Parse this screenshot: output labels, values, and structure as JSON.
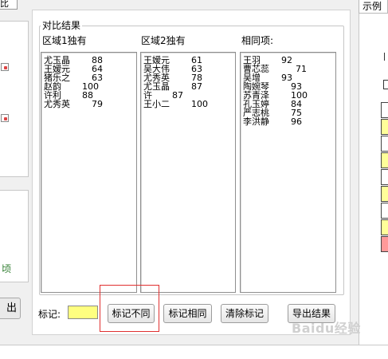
{
  "left_tab_label": "比",
  "left_green_text": "顷",
  "left_button_label": "出",
  "right_tab_label": "示例",
  "group_title": "对比结果",
  "columns": {
    "region1": {
      "label": "区域1独有",
      "items": [
        {
          "name": "尤玉晶",
          "value": "88"
        },
        {
          "name": "王嫒元",
          "value": "64"
        },
        {
          "name": "猪乐之",
          "value": "63"
        },
        {
          "name": "赵韵",
          "value": "100"
        },
        {
          "name": "许利",
          "value": "88"
        },
        {
          "name": "尤秀英",
          "value": "79"
        }
      ]
    },
    "region2": {
      "label": "区域2独有",
      "items": [
        {
          "name": "王嫒元",
          "value": "61"
        },
        {
          "name": "吴大伟",
          "value": "63"
        },
        {
          "name": "尤秀英",
          "value": "78"
        },
        {
          "name": "尤玉晶",
          "value": "87"
        },
        {
          "name": "许",
          "value": "87"
        },
        {
          "name": "王小二",
          "value": "100"
        }
      ]
    },
    "same": {
      "label": "相同项:",
      "items": [
        {
          "name": "王羽",
          "value": "92"
        },
        {
          "name": "曹芯蕊",
          "value": "71"
        },
        {
          "name": "吴增",
          "value": "93"
        },
        {
          "name": "陶婉琴",
          "value": "93"
        },
        {
          "name": "苏青泽",
          "value": "100"
        },
        {
          "name": "孔玉婷",
          "value": "84"
        },
        {
          "name": "严志桃",
          "value": "75"
        },
        {
          "name": "李洪静",
          "value": "96"
        }
      ]
    }
  },
  "footer": {
    "mark_label": "标记:",
    "mark_color": "#ffff80",
    "btn_mark_diff": "标记不同",
    "btn_mark_same": "标记相同",
    "btn_clear": "清除标记",
    "btn_export": "导出结果"
  },
  "watermark": "Baidu经验",
  "right_table_fills": [
    "#ffffff",
    "#ffff99",
    "#ffffff",
    "#ffff99",
    "#ffffff",
    "#ffff99",
    "#ffffff",
    "#ffff99",
    "#ff9999"
  ]
}
